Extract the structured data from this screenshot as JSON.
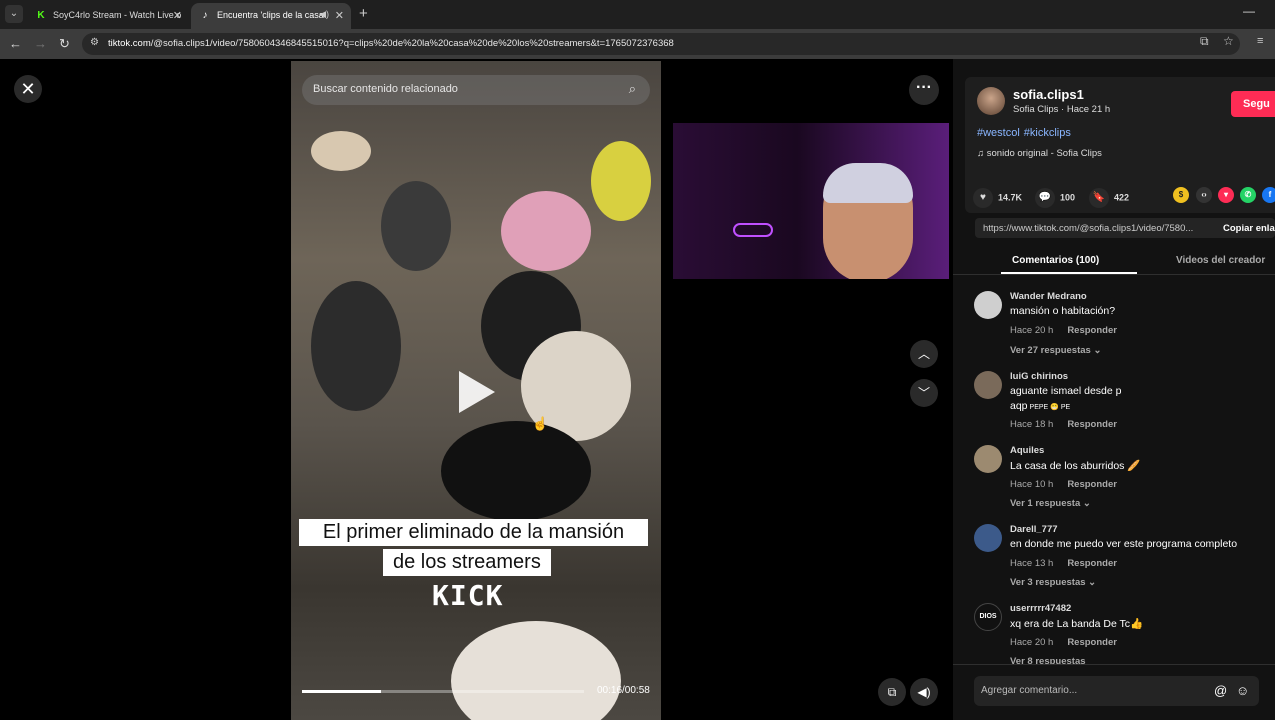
{
  "browser": {
    "tabs": [
      {
        "title": "SoyC4rlo Stream - Watch Live o",
        "active": false,
        "favicon": "kick-icon"
      },
      {
        "title": "Encuentra 'clips de la casa",
        "active": true,
        "favicon": "tiktok-icon"
      }
    ],
    "url_host": "tiktok.com",
    "url_rest": "/@sofia.clips1/video/7580604346845515016?q=clips%20de%20la%20casa%20de%20los%20streamers&t=1765072376368"
  },
  "video": {
    "search_placeholder": "Buscar contenido relacionado",
    "caption_line1": "El primer eliminado de la mansión",
    "caption_line2": "de los streamers",
    "watermark": "KICK",
    "timecode": "00:16/00:58",
    "progress": 0.28
  },
  "author": {
    "username": "sofia.clips1",
    "subtitle": "Sofia Clips · Hace 21 h",
    "follow_label": "Segu",
    "hashtags": [
      "#westcol",
      "#kickclips"
    ],
    "sound": "sonido original - Sofia Clips"
  },
  "stats": {
    "likes": "14.7K",
    "comments": "100",
    "saves": "422"
  },
  "share": {
    "link": "https://www.tiktok.com/@sofia.clips1/video/7580...",
    "copy_label": "Copiar enla"
  },
  "panel_tabs": {
    "comments": "Comentarios (100)",
    "creator_videos": "Videos del creador"
  },
  "comments": [
    {
      "user": "Wander Medrano",
      "text": "mansión o habitación?",
      "time": "Hace 20 h",
      "reply": "Responder",
      "replies": "Ver 27 respuestas",
      "avatar_color": "#cfcfcf"
    },
    {
      "user": "luiG chirinos",
      "text": "aguante ismael desde p",
      "text2": "aqp",
      "badge": "PEPE 😁 PE",
      "time": "Hace 18 h",
      "reply": "Responder",
      "replies": "",
      "avatar_color": "#7a6a5a"
    },
    {
      "user": "Aquiles",
      "text": "La casa de los aburridos 🥖",
      "time": "Hace 10 h",
      "reply": "Responder",
      "replies": "Ver 1 respuesta",
      "avatar_color": "#9c8a70"
    },
    {
      "user": "Darell_777",
      "text": "en donde me puedo ver este programa completo",
      "time": "Hace 13 h",
      "reply": "Responder",
      "replies": "Ver 3 respuestas",
      "avatar_color": "#3c5a8a"
    },
    {
      "user": "userrrrr47482",
      "text": "xq era de La banda De Tc👍",
      "time": "Hace 20 h",
      "reply": "Responder",
      "replies": "Ver 8 respuestas",
      "avatar_color": "#111111"
    }
  ],
  "comment_input": {
    "placeholder": "Agregar comentario..."
  },
  "colors": {
    "accent": "#fe2c55",
    "hashtag": "#8ab6ff",
    "panel_bg": "#121212"
  }
}
